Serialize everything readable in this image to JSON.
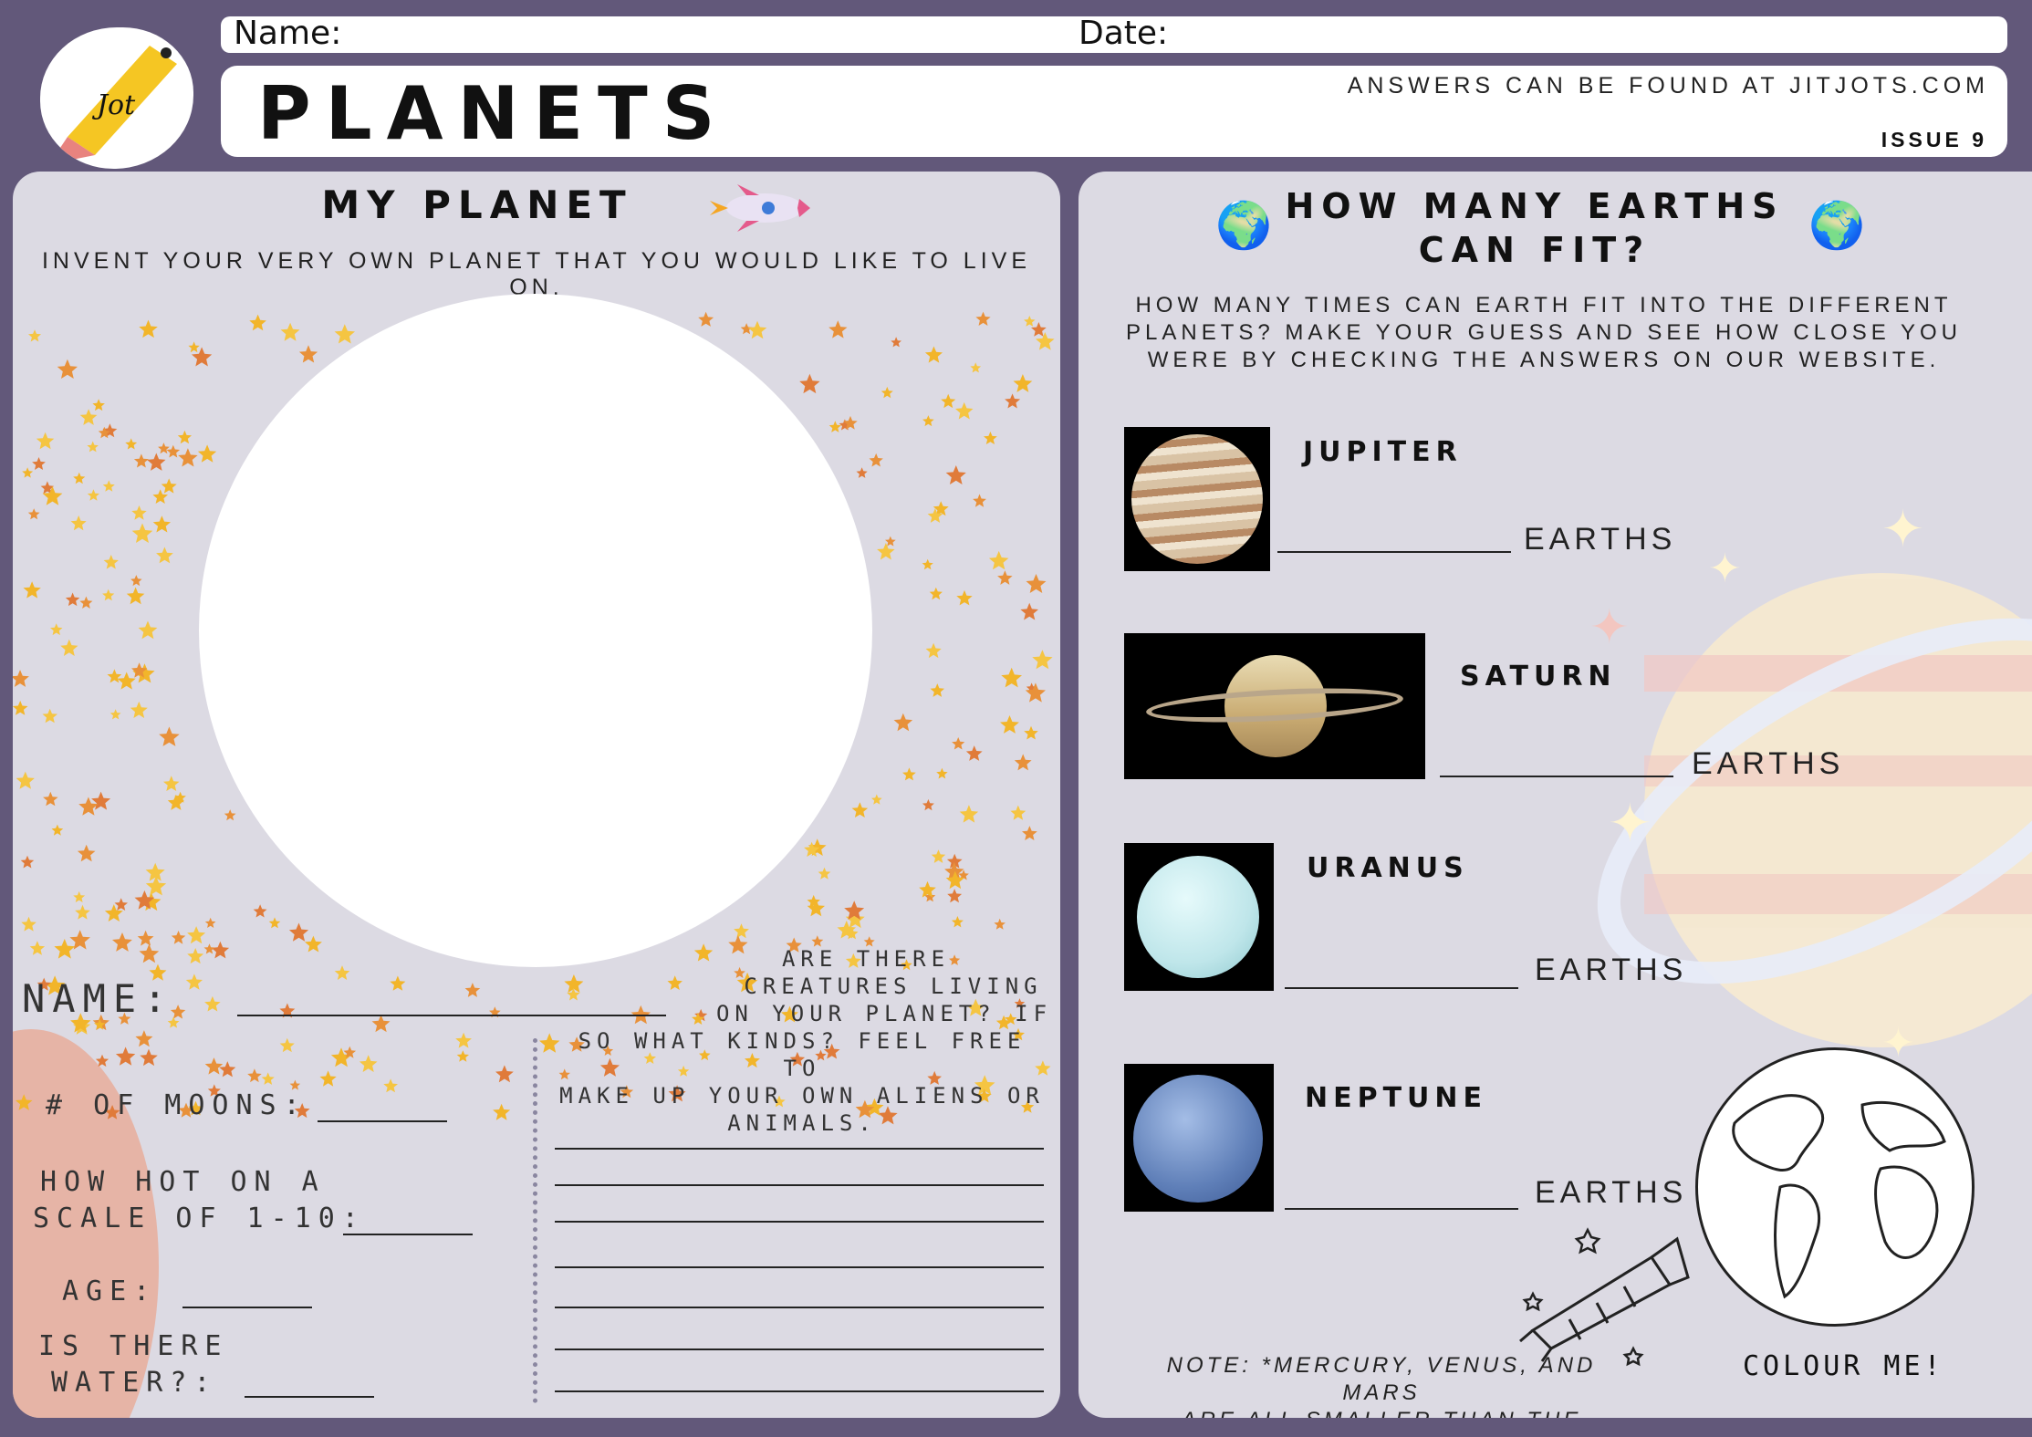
{
  "header": {
    "logo_text": "Jot",
    "name_label": "Name:",
    "date_label": "Date:",
    "title": "PLANETS",
    "answers_note": "ANSWERS CAN BE FOUND AT JITJOTS.COM",
    "issue": "ISSUE 9"
  },
  "my_planet": {
    "heading": "MY PLANET",
    "subheading": "INVENT YOUR VERY OWN PLANET THAT YOU WOULD LIKE TO LIVE ON.",
    "fields": {
      "name": "NAME:",
      "moons": "# OF MOONS:",
      "hot_1": "HOW HOT ON A",
      "hot_2": "SCALE OF 1-10:",
      "age": "AGE:",
      "water_1": "IS THERE",
      "water_2": "WATER?:"
    },
    "creatures": {
      "line1": "ARE THERE",
      "line2": "CREATURES LIVING",
      "line3": "ON YOUR PLANET? IF",
      "line4": "SO WHAT KINDS? FEEL FREE TO",
      "line5": "MAKE UP YOUR OWN ALIENS OR",
      "line6": "ANIMALS."
    }
  },
  "earths": {
    "heading_1": "HOW MANY EARTHS",
    "heading_2": "CAN FIT?",
    "intro_1": "HOW MANY TIMES CAN EARTH FIT INTO THE DIFFERENT",
    "intro_2": "PLANETS? MAKE YOUR GUESS AND SEE HOW CLOSE YOU",
    "intro_3": "WERE BY CHECKING THE ANSWERS ON OUR WEBSITE.",
    "planets": [
      {
        "name": "JUPITER",
        "unit": "EARTHS",
        "color": "#c9a27a"
      },
      {
        "name": "SATURN",
        "unit": "EARTHS",
        "color": "#d8c48e"
      },
      {
        "name": "URANUS",
        "unit": "EARTHS",
        "color": "#bfe6ea"
      },
      {
        "name": "NEPTUNE",
        "unit": "EARTHS",
        "color": "#5f7fb8"
      }
    ],
    "note_1": "NOTE: *MERCURY, VENUS, AND MARS",
    "note_2": "ARE ALL SMALLER THAN THE EARTH!*",
    "colour_me": "COLOUR ME!"
  }
}
